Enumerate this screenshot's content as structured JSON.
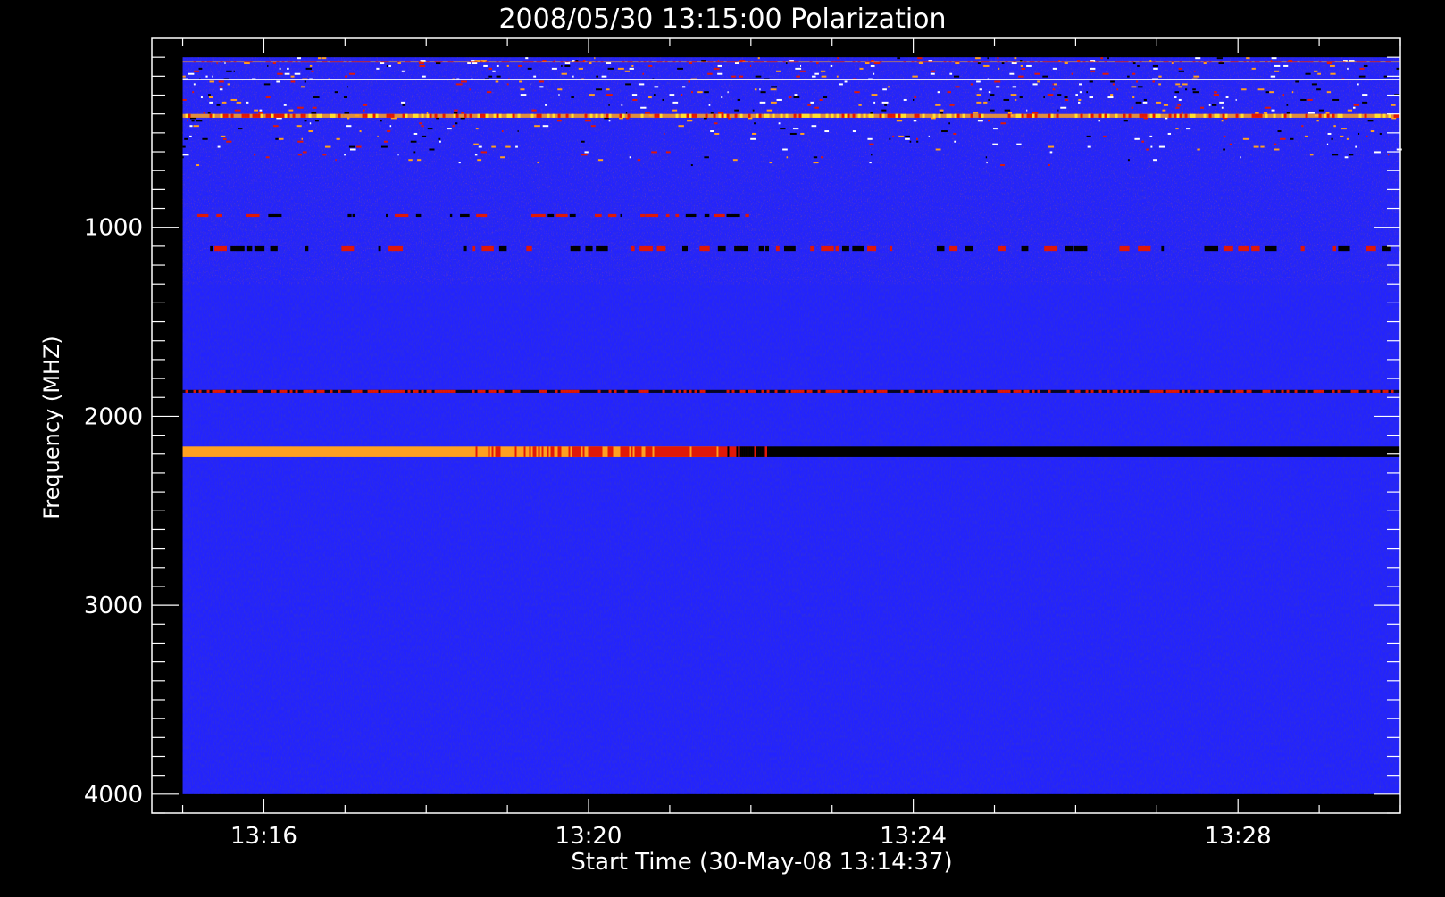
{
  "chart_data": {
    "type": "heatmap",
    "title": "2008/05/30 13:15:00 Polarization",
    "xlabel": "Start Time (30-May-08 13:14:37)",
    "ylabel": "Frequency (MHZ)",
    "x_tick_labels": [
      "13:16",
      "13:20",
      "13:24",
      "13:28"
    ],
    "x_tick_values_min": [
      16,
      20,
      24,
      28
    ],
    "x_range_min": [
      14.62,
      30.0
    ],
    "y_tick_labels": [
      "1000",
      "2000",
      "3000",
      "4000"
    ],
    "y_tick_values": [
      1000,
      2000,
      3000,
      4000
    ],
    "y_range_mhz": [
      0,
      4100
    ],
    "data_extent": {
      "time_min": [
        15.0,
        30.0
      ],
      "freq_mhz": [
        100,
        4000
      ]
    },
    "y_axis_inverted": true,
    "colormap": "blue background with red, orange, yellow and white highlights",
    "colors": {
      "background": "#000000",
      "frame": "#ffffff",
      "field": "#2323ff",
      "noise_dark": "#14149c",
      "noise_red": "#8a1a5a",
      "orange": "#ffa020",
      "red": "#e01808",
      "black": "#000000",
      "white": "#ffffff"
    },
    "features": [
      {
        "time_min": [
          15.0,
          30.0
        ],
        "freq_mhz": [
          100,
          680
        ],
        "pattern": "noisy",
        "colors": [
          "red",
          "orange",
          "white",
          "black"
        ]
      },
      {
        "time_min": [
          15.0,
          30.0
        ],
        "freq_mhz": [
          120,
          128
        ],
        "pattern": "stripe",
        "colors": [
          "orange",
          "red"
        ]
      },
      {
        "time_min": [
          15.0,
          30.0
        ],
        "freq_mhz": [
          215,
          222
        ],
        "pattern": "stripe",
        "colors": [
          "white"
        ]
      },
      {
        "time_min": [
          15.0,
          30.0
        ],
        "freq_mhz": [
          400,
          420
        ],
        "pattern": "stripe",
        "colors": [
          "orange",
          "yellow",
          "red"
        ]
      },
      {
        "time_min": [
          15.0,
          22.0
        ],
        "freq_mhz": [
          930,
          945
        ],
        "pattern": "dashed",
        "colors": [
          "black",
          "red"
        ]
      },
      {
        "time_min": [
          15.0,
          30.0
        ],
        "freq_mhz": [
          1100,
          1125
        ],
        "pattern": "dashed",
        "colors": [
          "red",
          "black"
        ]
      },
      {
        "time_min": [
          15.0,
          30.0
        ],
        "freq_mhz": [
          1860,
          1875
        ],
        "pattern": "stripe",
        "colors": [
          "black",
          "red"
        ]
      },
      {
        "time_min": [
          15.0,
          18.3
        ],
        "freq_mhz": [
          2160,
          2215
        ],
        "pattern": "solid",
        "colors": [
          "orange"
        ]
      },
      {
        "time_min": [
          18.3,
          21.6
        ],
        "freq_mhz": [
          2160,
          2215
        ],
        "pattern": "mixed",
        "colors": [
          "orange",
          "red"
        ]
      },
      {
        "time_min": [
          21.6,
          22.2
        ],
        "freq_mhz": [
          2160,
          2215
        ],
        "pattern": "mixed",
        "colors": [
          "red",
          "black"
        ]
      },
      {
        "time_min": [
          22.2,
          30.0
        ],
        "freq_mhz": [
          2160,
          2215
        ],
        "pattern": "solid",
        "colors": [
          "black"
        ]
      }
    ]
  }
}
